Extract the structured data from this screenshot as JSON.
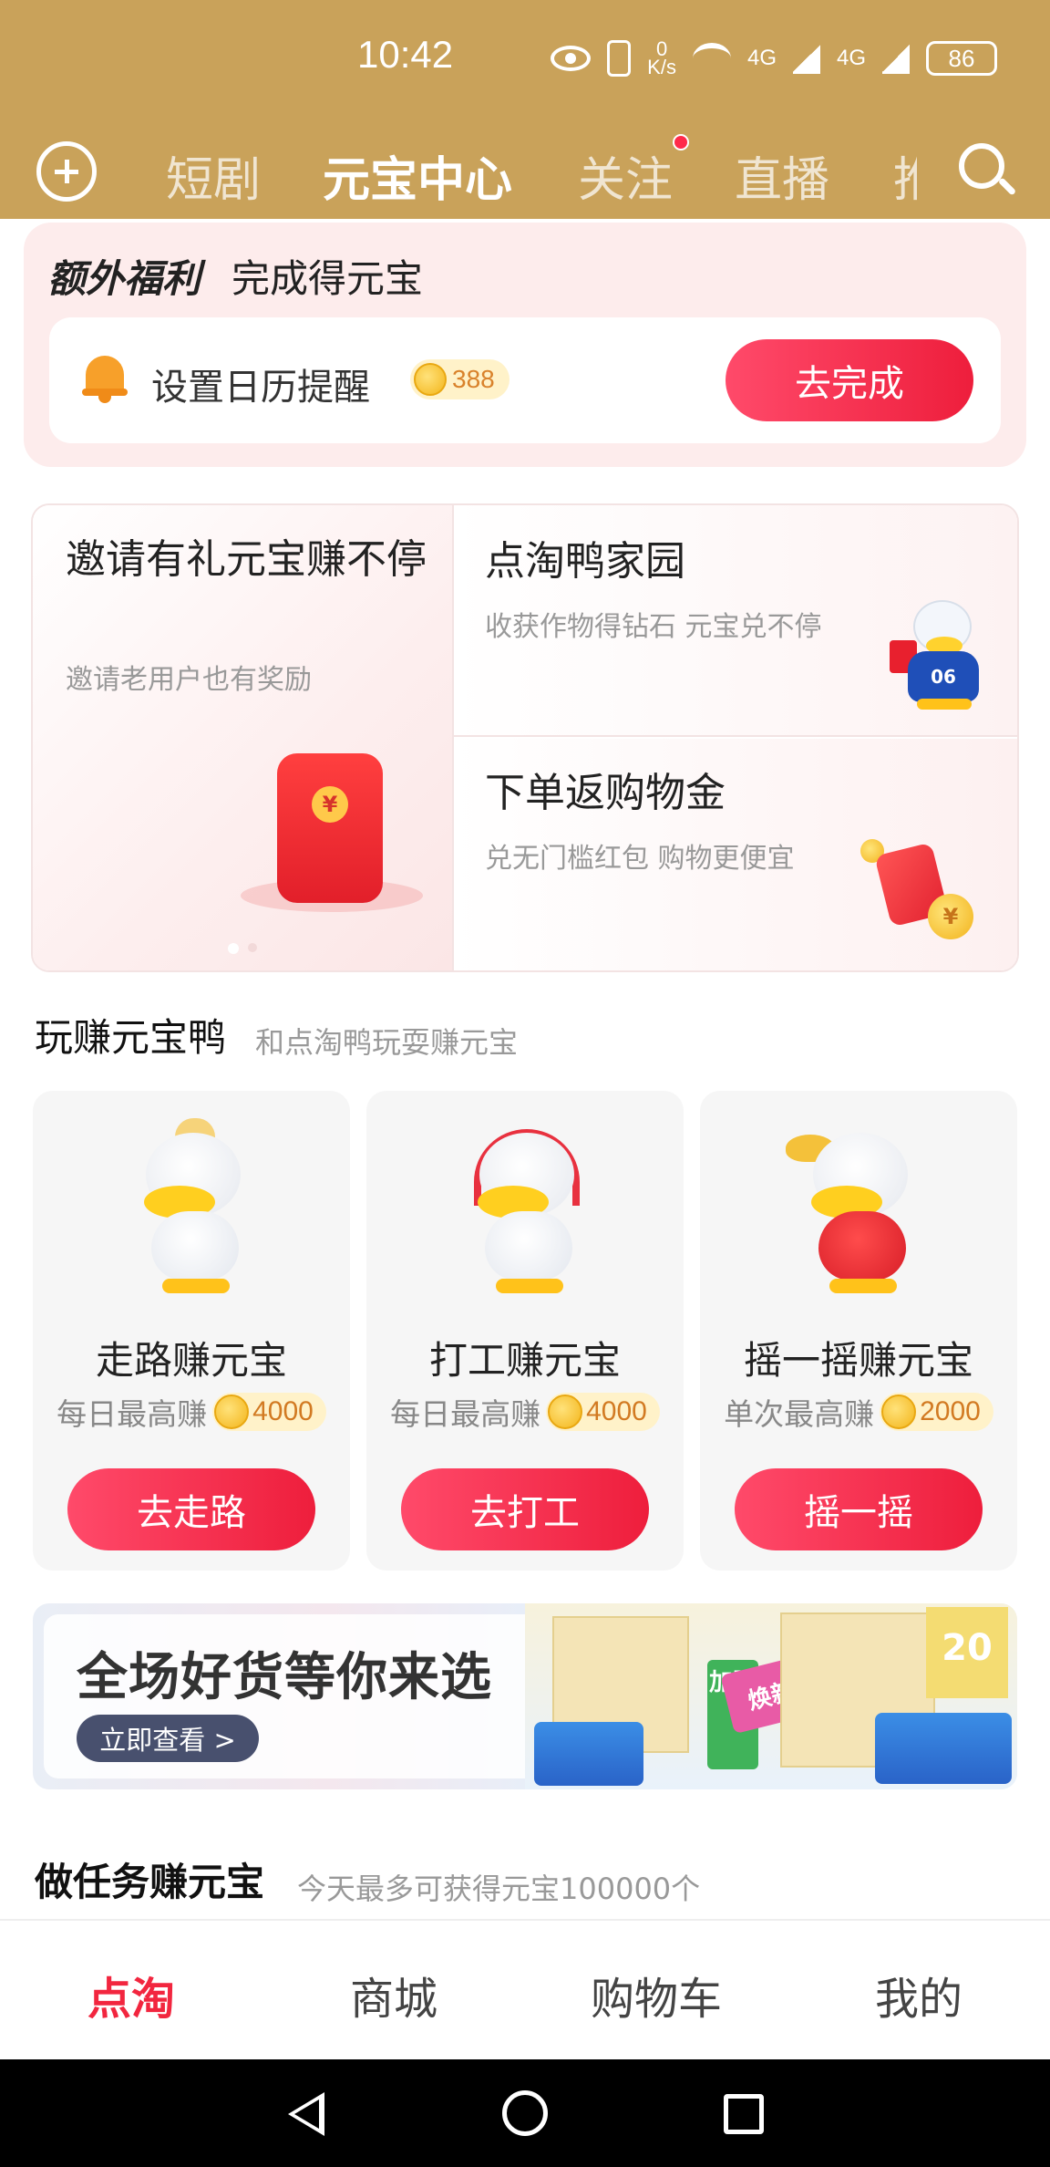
{
  "status_bar": {
    "time": "10:42",
    "net_speed_top": "0",
    "net_speed_bottom": "K/s",
    "sig1": "4G",
    "sig2": "4G",
    "battery": "86"
  },
  "top_nav": {
    "tabs": [
      {
        "label": "短剧",
        "active": false
      },
      {
        "label": "元宝中心",
        "active": true
      },
      {
        "label": "关注",
        "active": false,
        "dot": true
      },
      {
        "label": "直播",
        "active": false
      },
      {
        "label": "推",
        "active": false
      }
    ],
    "colors": {
      "header_bg": "#c9a25a",
      "accent_red": "#f2263f"
    }
  },
  "extra_bonus": {
    "title": "额外福利",
    "subtitle": "完成得元宝",
    "task_label": "设置日历提醒",
    "reward": "388",
    "button": "去完成"
  },
  "promos": {
    "left": {
      "title": "邀请有礼元宝赚不停",
      "subtitle": "邀请老用户也有奖励",
      "seal": "¥"
    },
    "right_top": {
      "title": "点淘鸭家园",
      "subtitle": "收获作物得钻石 元宝兑不停",
      "shirt_number": "06"
    },
    "right_bottom": {
      "title": "下单返购物金",
      "subtitle": "兑无门槛红包 购物更便宜",
      "seal": "¥"
    }
  },
  "play_section": {
    "title": "玩赚元宝鸭",
    "subtitle": "和点淘鸭玩耍赚元宝",
    "games": [
      {
        "name": "走路赚元宝",
        "limit_label": "每日最高赚",
        "amount": "4000",
        "button": "去走路"
      },
      {
        "name": "打工赚元宝",
        "limit_label": "每日最高赚",
        "amount": "4000",
        "button": "去打工"
      },
      {
        "name": "摇一摇赚元宝",
        "limit_label": "单次最高赚",
        "amount": "2000",
        "button": "摇一摇"
      }
    ]
  },
  "banner": {
    "title": "全场好货等你来选",
    "button": "立即查看 >",
    "tag_text": "焕新升级",
    "green_tag": "加赠",
    "gold_tag": "20"
  },
  "task_section": {
    "title": "做任务赚元宝",
    "subtitle": "今天最多可获得元宝100000个"
  },
  "bottom_nav": {
    "items": [
      {
        "label": "点淘",
        "active": true
      },
      {
        "label": "商城",
        "active": false
      },
      {
        "label": "购物车",
        "active": false
      },
      {
        "label": "我的",
        "active": false
      }
    ]
  }
}
